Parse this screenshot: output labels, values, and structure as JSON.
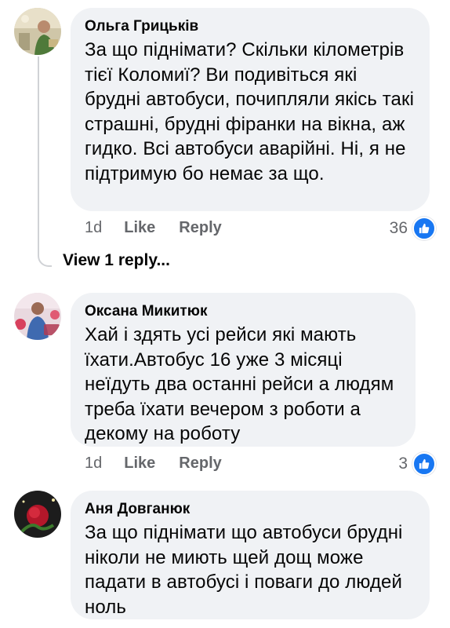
{
  "comments": [
    {
      "author": "Ольга Грицьків",
      "text": "За що піднімати? Скільки кілометрів тієї Коломиї? Ви подивіться які брудні автобуси, почипляли якісь такі страшні, брудні фіранки на вікна, аж гидко. Всі автобуси аварійні. Ні, я не підтримую бо немає за що.",
      "time": "1d",
      "like_label": "Like",
      "reply_label": "Reply",
      "reaction_count": "36",
      "reaction_icon": "like-icon"
    },
    {
      "author": "Оксана Микитюк",
      "text": "Хай і здять усі рейси які мають їхати.Автобус 16 уже 3 місяці неїдуть два останні рейси а людям треба їхати вечером з роботи а декому на роботу",
      "time": "1d",
      "like_label": "Like",
      "reply_label": "Reply",
      "reaction_count": "3",
      "reaction_icon": "like-icon"
    },
    {
      "author": "Аня Довганюк",
      "text": "За що піднімати що автобуси брудні ніколи не миють щей дощ може падати в автобусі і поваги до людей ноль"
    }
  ],
  "view_replies_label": "View 1 reply...",
  "colors": {
    "bubble": "#f0f2f5",
    "meta": "#65676b",
    "like_blue": "#1877f2"
  }
}
